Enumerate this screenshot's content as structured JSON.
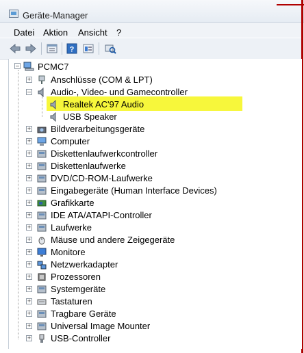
{
  "window": {
    "title": "Geräte-Manager"
  },
  "menu": {
    "items": [
      "Datei",
      "Aktion",
      "Ansicht",
      "?"
    ]
  },
  "toolbar": {
    "buttons": [
      "back-icon",
      "forward-icon",
      "properties-icon",
      "help-icon",
      "view-icon",
      "scan-hardware-icon"
    ]
  },
  "tree": {
    "root": "PCMC7",
    "categories": [
      {
        "label": "Anschlüsse (COM & LPT)",
        "icon": "port-icon",
        "expanded": false
      },
      {
        "label": "Audio-, Video- und Gamecontroller",
        "icon": "speaker-icon",
        "expanded": true,
        "children": [
          {
            "label": "Realtek AC'97 Audio",
            "icon": "speaker-icon",
            "highlighted": true
          },
          {
            "label": "USB Speaker",
            "icon": "speaker-icon"
          }
        ]
      },
      {
        "label": "Bildverarbeitungsgeräte",
        "icon": "camera-icon",
        "expanded": false
      },
      {
        "label": "Computer",
        "icon": "computer-icon",
        "expanded": false
      },
      {
        "label": "Diskettenlaufwerkcontroller",
        "icon": "floppy-controller-icon",
        "expanded": false
      },
      {
        "label": "Diskettenlaufwerke",
        "icon": "floppy-icon",
        "expanded": false
      },
      {
        "label": "DVD/CD-ROM-Laufwerke",
        "icon": "dvd-icon",
        "expanded": false
      },
      {
        "label": "Eingabegeräte (Human Interface Devices)",
        "icon": "hid-icon",
        "expanded": false
      },
      {
        "label": "Grafikkarte",
        "icon": "display-adapter-icon",
        "expanded": false
      },
      {
        "label": "IDE ATA/ATAPI-Controller",
        "icon": "ide-icon",
        "expanded": false
      },
      {
        "label": "Laufwerke",
        "icon": "drive-icon",
        "expanded": false
      },
      {
        "label": "Mäuse und andere Zeigegeräte",
        "icon": "mouse-icon",
        "expanded": false
      },
      {
        "label": "Monitore",
        "icon": "monitor-icon",
        "expanded": false
      },
      {
        "label": "Netzwerkadapter",
        "icon": "network-icon",
        "expanded": false
      },
      {
        "label": "Prozessoren",
        "icon": "processor-icon",
        "expanded": false
      },
      {
        "label": "Systemgeräte",
        "icon": "system-icon",
        "expanded": false
      },
      {
        "label": "Tastaturen",
        "icon": "keyboard-icon",
        "expanded": false
      },
      {
        "label": "Tragbare Geräte",
        "icon": "portable-icon",
        "expanded": false
      },
      {
        "label": "Universal Image Mounter",
        "icon": "image-mounter-icon",
        "expanded": false
      },
      {
        "label": "USB-Controller",
        "icon": "usb-icon",
        "expanded": false
      }
    ]
  },
  "colors": {
    "highlight": "#f7f73b",
    "accent": "#b00000"
  }
}
